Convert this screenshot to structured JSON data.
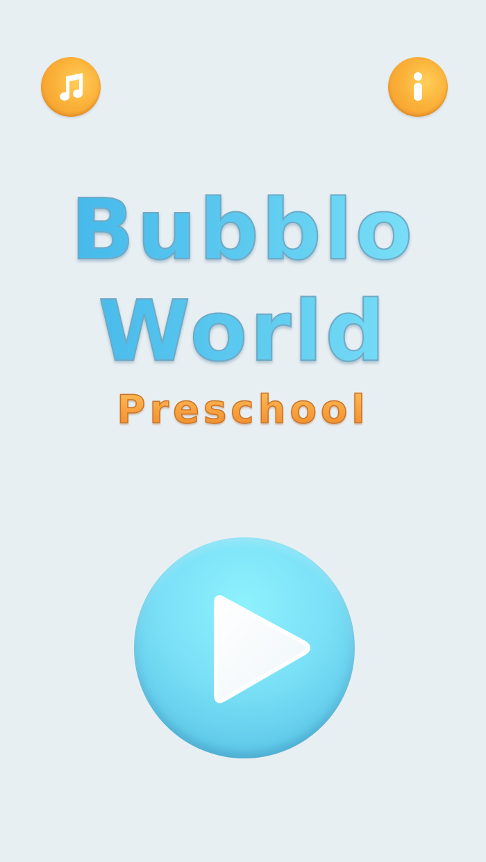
{
  "header": {
    "music_icon": "music-note-icon",
    "info_icon": "info-icon"
  },
  "title": {
    "line1": "Bubblo",
    "line2": "World",
    "subtitle": "Preschool"
  },
  "play": {
    "icon": "play-icon"
  },
  "colors": {
    "background": "#e8eff3",
    "orange_button": "#fbb23a",
    "title_blue_start": "#3db3ea",
    "title_blue_end": "#86e8fb",
    "subtitle_orange": "#f08a2a",
    "play_button": "#7ae0f7"
  }
}
